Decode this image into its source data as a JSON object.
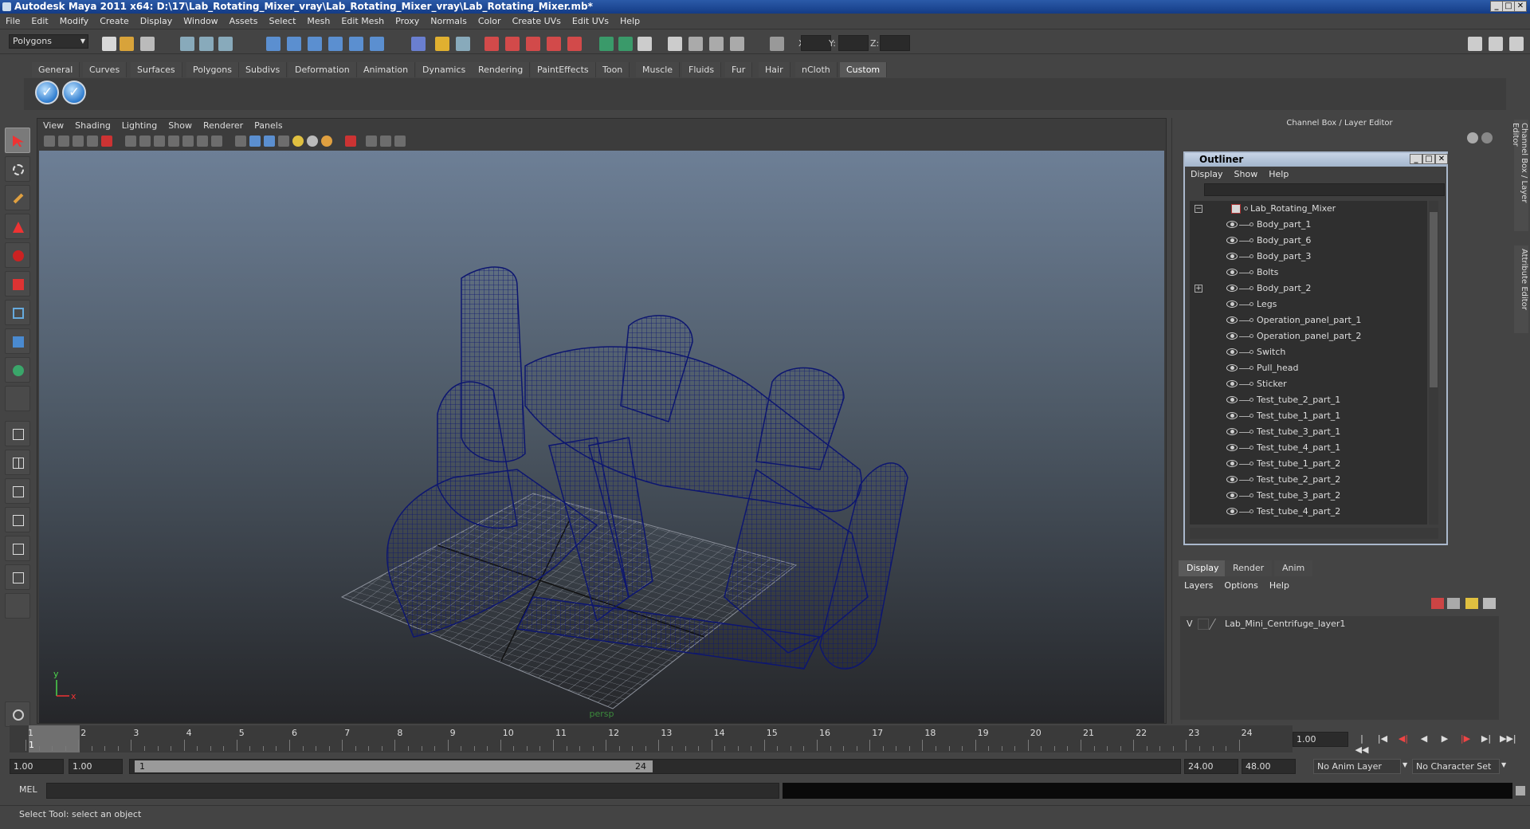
{
  "window": {
    "title": "Autodesk Maya 2011 x64: D:\\17\\Lab_Rotating_Mixer_vray\\Lab_Rotating_Mixer_vray\\Lab_Rotating_Mixer.mb*",
    "min_label": "_",
    "max_label": "□",
    "close_label": "✕"
  },
  "menubar": {
    "items": [
      "File",
      "Edit",
      "Modify",
      "Create",
      "Display",
      "Window",
      "Assets",
      "Select",
      "Mesh",
      "Edit Mesh",
      "Proxy",
      "Normals",
      "Color",
      "Create UVs",
      "Edit UVs",
      "Help"
    ]
  },
  "statusline": {
    "mode_value": "Polygons",
    "x_label": "X:",
    "y_label": "Y:",
    "z_label": "Z:"
  },
  "shelf": {
    "tabs": [
      "General",
      "Curves",
      "Surfaces",
      "Polygons",
      "Subdivs",
      "Deformation",
      "Animation",
      "Dynamics",
      "Rendering",
      "PaintEffects",
      "Toon",
      "Muscle",
      "Fluids",
      "Fur",
      "Hair",
      "nCloth",
      "Custom"
    ],
    "active_tab": "Custom",
    "button_glyph": "✓"
  },
  "viewport": {
    "menu": [
      "View",
      "Shading",
      "Lighting",
      "Show",
      "Renderer",
      "Panels"
    ],
    "camera_label": "persp",
    "axis_x": "x",
    "axis_y": "y",
    "wire_color": "#0d1670"
  },
  "channel_box": {
    "title": "Channel Box / Layer Editor"
  },
  "outliner": {
    "title": "Outliner",
    "menu": [
      "Display",
      "Show",
      "Help"
    ],
    "root": "Lab_Rotating_Mixer",
    "items": [
      "Body_part_1",
      "Body_part_6",
      "Body_part_3",
      "Bolts",
      "Body_part_2",
      "Legs",
      "Operation_panel_part_1",
      "Operation_panel_part_2",
      "Switch",
      "Pull_head",
      "Sticker",
      "Test_tube_2_part_1",
      "Test_tube_1_part_1",
      "Test_tube_3_part_1",
      "Test_tube_4_part_1",
      "Test_tube_1_part_2",
      "Test_tube_2_part_2",
      "Test_tube_3_part_2",
      "Test_tube_4_part_2"
    ],
    "collapse_label": "−",
    "expand_label": "+"
  },
  "layer_editor": {
    "tabs": [
      "Display",
      "Render",
      "Anim"
    ],
    "menu": [
      "Layers",
      "Options",
      "Help"
    ],
    "layer_visibility": "V",
    "layer_name": "Lab_Mini_Centrifuge_layer1"
  },
  "side_tabs": [
    "Channel Box / Layer Editor",
    "Attribute Editor"
  ],
  "timeline": {
    "ticks": [
      "1",
      "2",
      "3",
      "4",
      "5",
      "6",
      "7",
      "8",
      "9",
      "10",
      "11",
      "12",
      "13",
      "14",
      "15",
      "16",
      "17",
      "18",
      "19",
      "20",
      "21",
      "22",
      "23",
      "24"
    ],
    "current_frame_marker": "1",
    "current_frame_field": "1.00",
    "playback_buttons": [
      "|◀◀",
      "|◀",
      "◀|",
      "◀",
      "▶",
      "|▶",
      "▶|",
      "▶▶|"
    ]
  },
  "range": {
    "start": "1.00",
    "playback_start": "1.00",
    "slider_start": "1",
    "slider_end": "24",
    "playback_end": "24.00",
    "end": "48.00",
    "anim_layer": "No Anim Layer",
    "character_set": "No Character Set"
  },
  "command": {
    "label": "MEL"
  },
  "help": {
    "text": "Select Tool: select an object"
  }
}
